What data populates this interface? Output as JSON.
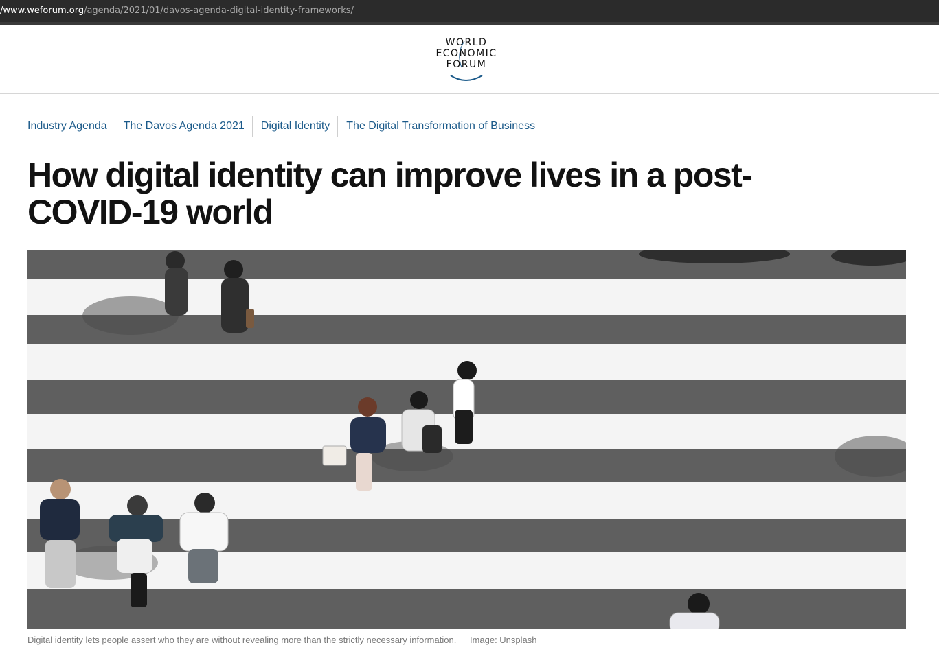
{
  "browser": {
    "url_host": "/www.weforum.org",
    "url_path": "/agenda/2021/01/davos-agenda-digital-identity-frameworks/"
  },
  "header": {
    "logo_lines": [
      "WORLD",
      "ECONOMIC",
      "FORUM"
    ],
    "brand_color": "#1b5a8a"
  },
  "article": {
    "tags": [
      {
        "label": "Industry Agenda"
      },
      {
        "label": "The Davos Agenda 2021"
      },
      {
        "label": "Digital Identity"
      },
      {
        "label": "The Digital Transformation of Business"
      }
    ],
    "title": "How digital identity can improve lives in a post-COVID-19 world",
    "image": {
      "description_icon": "photo-crosswalk-pedestrians",
      "caption": "Digital identity lets people assert who they are without revealing more than the strictly necessary information.",
      "credit": "Image: Unsplash"
    }
  }
}
